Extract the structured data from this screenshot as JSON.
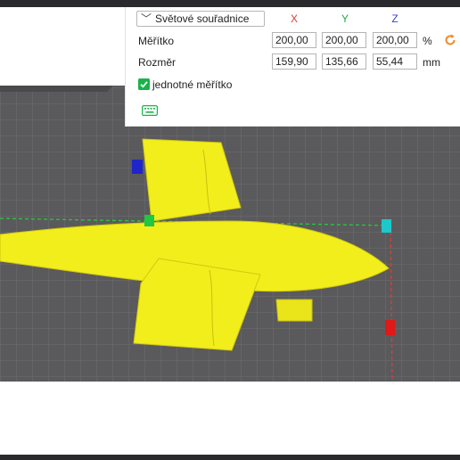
{
  "panel": {
    "coord_system": "Světové souřadnice",
    "axes": [
      {
        "label": "X",
        "color": "#e53935"
      },
      {
        "label": "Y",
        "color": "#27a844"
      },
      {
        "label": "Z",
        "color": "#3b43d6"
      }
    ],
    "scale": {
      "label": "Měřítko",
      "x": "200,00",
      "y": "200,00",
      "z": "200,00",
      "unit": "%"
    },
    "size": {
      "label": "Rozměr",
      "x": "159,90",
      "y": "135,66",
      "z": "55,44",
      "unit": "mm"
    },
    "uniform": {
      "label": "jednotné měřítko",
      "checked": true
    },
    "icons": {
      "reset": "reset-icon",
      "keyboard": "keyboard-icon",
      "dropdown": "chevron-down-icon"
    }
  },
  "colors": {
    "accent_orange": "#f08a24",
    "check_green": "#19b34a",
    "model_yellow": "#f2ee1c",
    "grid_bg": "#5a5a5c"
  }
}
